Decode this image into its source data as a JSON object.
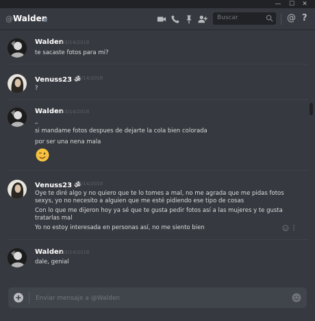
{
  "window": {
    "minimize": "—",
    "maximize": "☐",
    "close": "✕"
  },
  "header": {
    "at_symbol": "@",
    "channel_name": "Walden",
    "search_placeholder": "Buscar",
    "mention_symbol": "@",
    "help_symbol": "?"
  },
  "messages": [
    {
      "author": "Walden",
      "timestamp": "03/14/2018",
      "lines": [
        "te sacaste fotos para mi?"
      ]
    },
    {
      "author": "Venuss23 ॐ",
      "timestamp": "03/14/2018",
      "lines": [
        "?"
      ]
    },
    {
      "author": "Walden",
      "timestamp": "03/14/2018",
      "lines": [
        "_",
        "si mandame fotos despues de dejarte la cola bien colorada",
        "por ser una nena mala"
      ],
      "emoji": "winking-face"
    },
    {
      "author": "Venuss23 ॐ",
      "timestamp": "03/14/2018",
      "lines": [
        "Oye te diré algo y no quiero que te lo tomes a mal, no me agrada que me pidas fotos",
        "sexys, yo no necesito a alguien que me esté pidiendo ese tipo de cosas",
        "Con lo que me dijeron hoy ya sé que te gusta pedir fotos así a las mujeres y te gusta",
        "tratarlas mal",
        "Yo no estoy interesada en personas así, no me siento bien"
      ]
    },
    {
      "author": "Walden",
      "timestamp": "03/14/2018",
      "lines": [
        "dale, genial"
      ]
    }
  ],
  "composer": {
    "placeholder": "Enviar mensaje a @Walden"
  },
  "colors": {
    "background": "#36393f",
    "titlebar": "#202225",
    "composer": "#40444b",
    "username": "#ffffff",
    "text": "#dcddde"
  }
}
